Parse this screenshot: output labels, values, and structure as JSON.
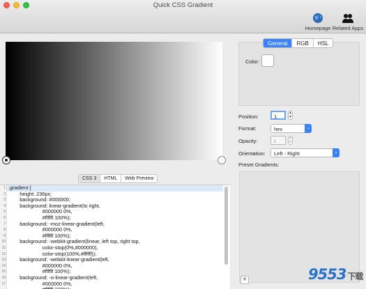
{
  "window": {
    "title": "Quick CSS Gradient"
  },
  "toolbar": {
    "homepage": "Homepage",
    "related_apps": "Related Apps"
  },
  "gradient": {
    "start_color": "#000000",
    "end_color": "#ffffff",
    "direction": "to right"
  },
  "code_tabs": [
    "CSS 3",
    "HTML",
    "Web Preview"
  ],
  "code_lines": [
    ".gradient {",
    "        height: 236px;",
    "        background: #000000;",
    "        background: linear-gradient(to right,",
    "                        #000000 0%,",
    "                        #ffffff 100%);",
    "        background: -moz-linear-gradient(left,",
    "                        #000000 0%,",
    "                        #ffffff 100%);",
    "        background: -webkit-gradient(linear, left top, right top,",
    "                        color-stop(0%,#000000),",
    "                        color-stop(100%,#ffffff));",
    "        background: -webkit-linear-gradient(left,",
    "                        #000000 0%,",
    "                        #ffffff 100%);",
    "        background: -o-linear-gradient(left,",
    "                        #000000 0%,",
    "                        #ffffff 100%);"
  ],
  "line_numbers": [
    "1",
    "2",
    "3",
    "4",
    "5",
    "6",
    "7",
    "8",
    "9",
    "10",
    "11",
    "12",
    "13",
    "14",
    "15",
    "16",
    "17"
  ],
  "panel": {
    "tabs": [
      "General",
      "RGB",
      "HSL"
    ],
    "color_label": "Color:",
    "position_label": "Position:",
    "position_value": "1",
    "format_label": "Format:",
    "format_value": "hex",
    "opacity_label": "Opacity:",
    "opacity_value": "1",
    "orientation_label": "Orientation:",
    "orientation_value": "Left - Right",
    "presets_label": "Preset Gradients:",
    "add_label": "+"
  },
  "watermark": {
    "text": "9553",
    "suffix": "下载"
  },
  "colors": {
    "accent": "#3b82f6",
    "close": "#fc5f57",
    "minimize": "#fdbc2e",
    "maximize": "#28c840"
  }
}
